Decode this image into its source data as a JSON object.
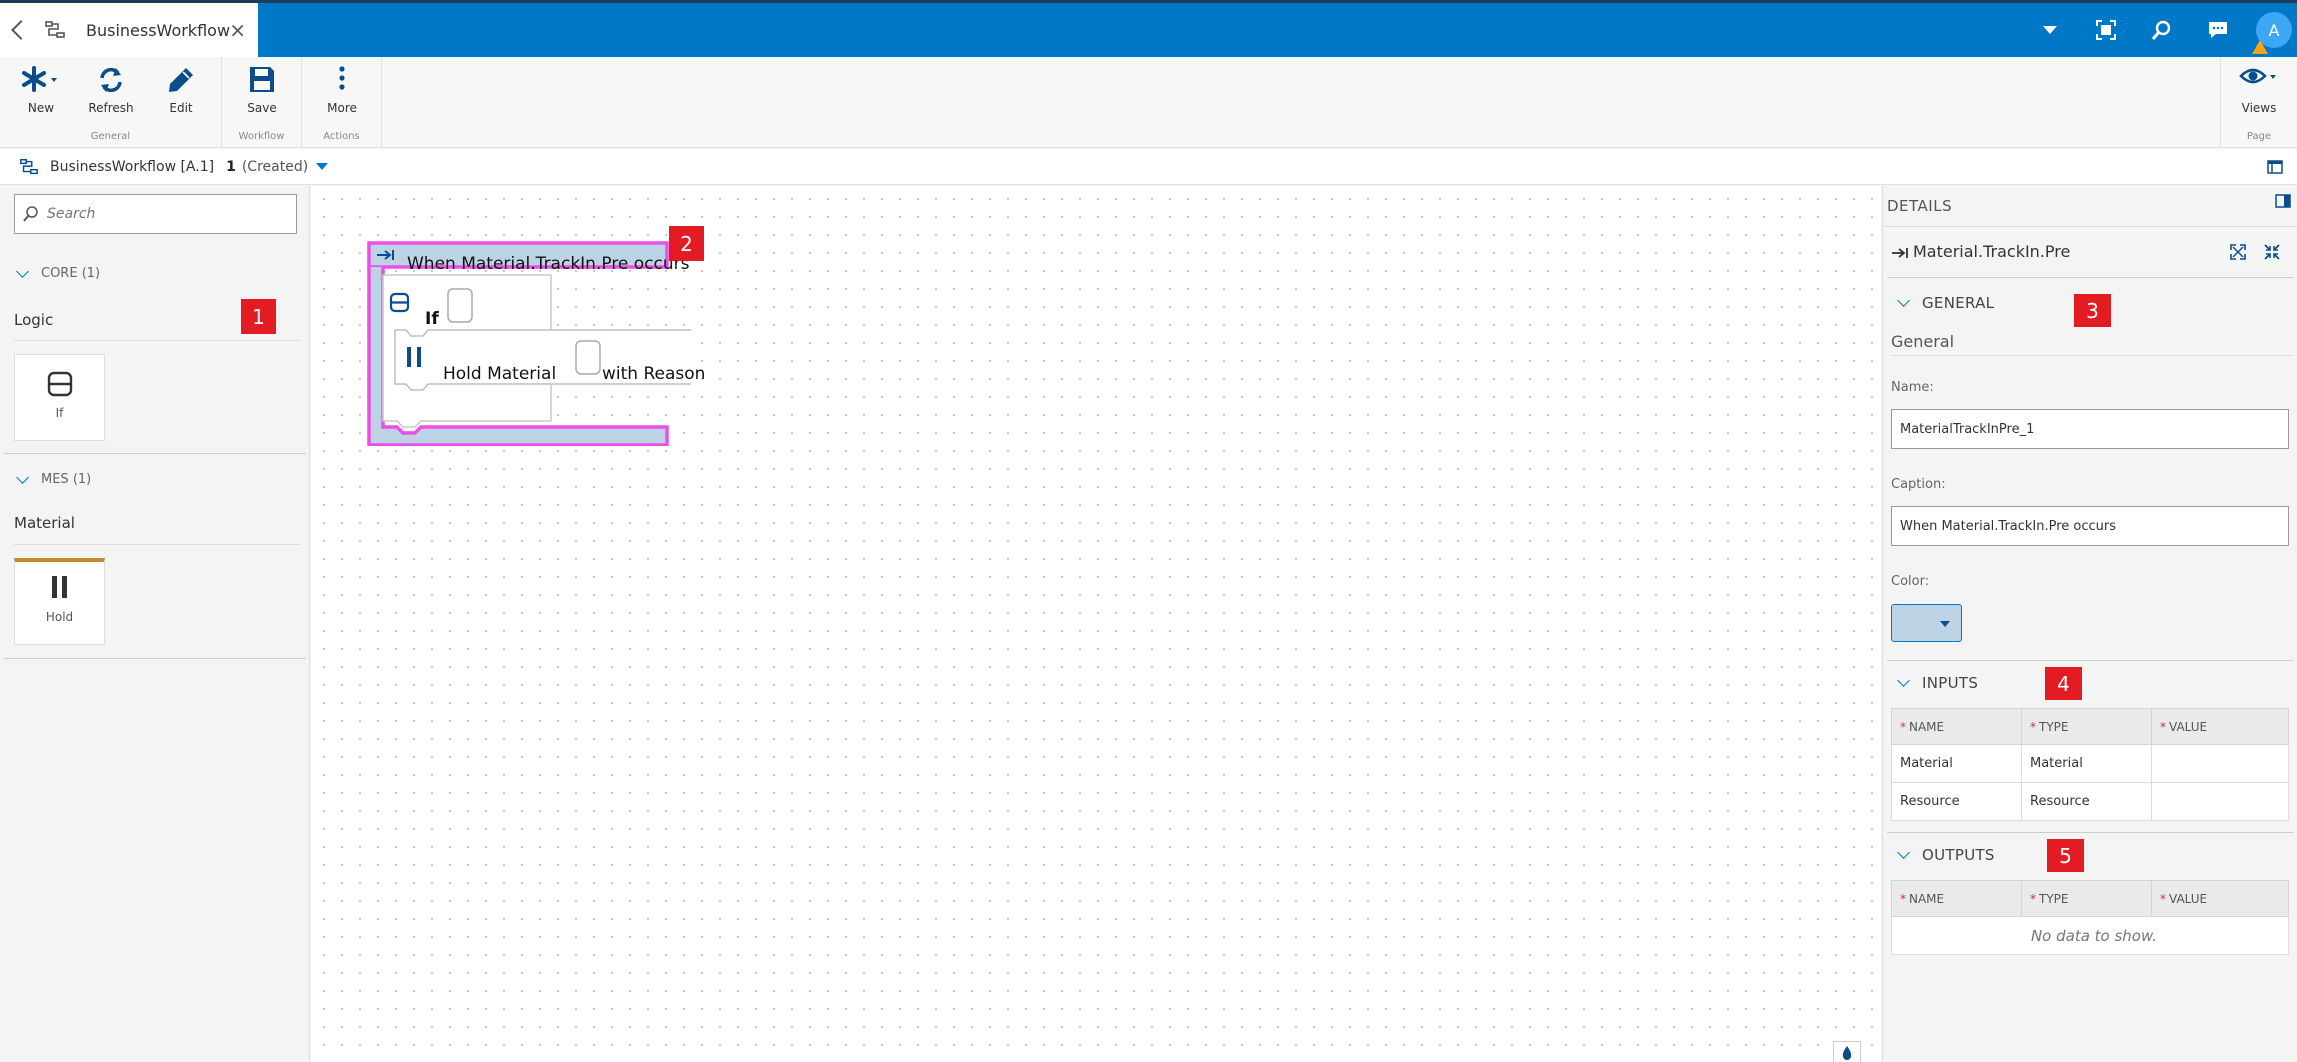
{
  "tab": {
    "title": "BusinessWorkflow",
    "close_symbol": "×"
  },
  "header": {
    "avatar_initial": "A"
  },
  "ribbon": {
    "groups": [
      {
        "label": "General",
        "buttons": [
          {
            "label": "New"
          },
          {
            "label": "Refresh"
          },
          {
            "label": "Edit"
          }
        ]
      },
      {
        "label": "Workflow",
        "buttons": [
          {
            "label": "Save"
          }
        ]
      },
      {
        "label": "Actions",
        "buttons": [
          {
            "label": "More"
          }
        ]
      },
      {
        "label": "Page",
        "buttons": [
          {
            "label": "Views"
          }
        ]
      }
    ]
  },
  "breadcrumb": {
    "name": "BusinessWorkflow [A.1]",
    "version": "1",
    "state": "(Created)"
  },
  "toolbox": {
    "search_placeholder": "Search",
    "sections": [
      {
        "header": "CORE (1)",
        "subheader": "Logic",
        "items": [
          {
            "label": "If",
            "icon": "if-block-icon"
          }
        ]
      },
      {
        "header": "MES (1)",
        "subheader": "Material",
        "items": [
          {
            "label": "Hold",
            "icon": "pause-icon"
          }
        ]
      }
    ]
  },
  "canvas": {
    "event_block": "When Material.TrackIn.Pre occurs",
    "if_block": "If",
    "hold_block": "Hold Material",
    "reason_label": "with Reason",
    "colors": {
      "outline": "#ec4fe6",
      "block_fill": "#bcd3e6",
      "accent": "#0b4d8a"
    }
  },
  "annotations": [
    "1",
    "2",
    "3",
    "4",
    "5"
  ],
  "details": {
    "title": "DETAILS",
    "selected": "Material.TrackIn.Pre",
    "general": {
      "header": "GENERAL",
      "subheader": "General",
      "name_label": "Name:",
      "name_value": "MaterialTrackInPre_1",
      "caption_label": "Caption:",
      "caption_value": "When Material.TrackIn.Pre occurs",
      "color_label": "Color:"
    },
    "inputs": {
      "header": "INPUTS",
      "columns": [
        "NAME",
        "TYPE",
        "VALUE"
      ],
      "rows": [
        [
          "Material",
          "Material",
          ""
        ],
        [
          "Resource",
          "Resource",
          ""
        ]
      ]
    },
    "outputs": {
      "header": "OUTPUTS",
      "columns": [
        "NAME",
        "TYPE",
        "VALUE"
      ],
      "empty_text": "No data to show."
    }
  },
  "colors": {
    "primary": "#0078c8",
    "annotation": "#e31b23",
    "required": "#d32f2f"
  }
}
